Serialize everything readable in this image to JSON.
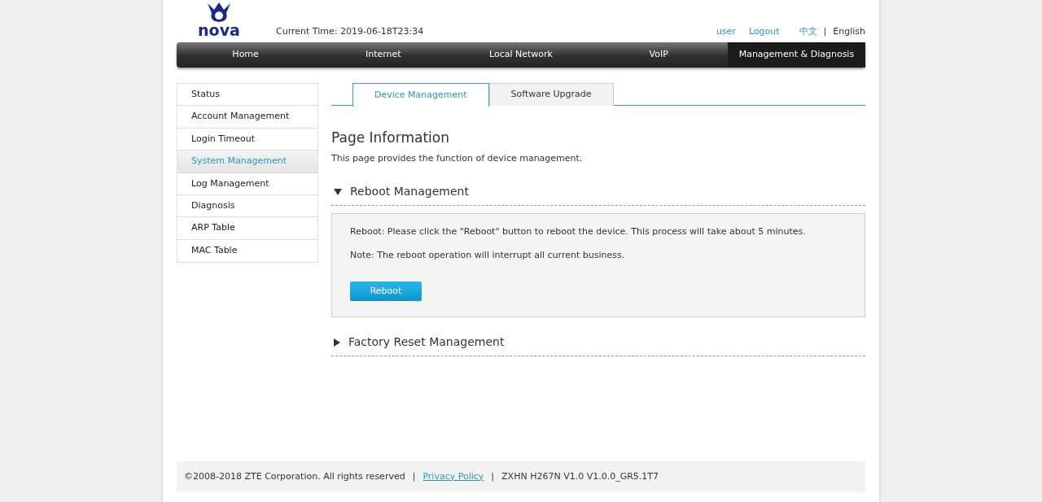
{
  "header": {
    "logo_text": "nova",
    "current_time": "Current Time: 2019-06-18T23:34",
    "user": "user",
    "logout": "Logout",
    "languages": [
      {
        "label": "中文",
        "selected": false
      },
      {
        "label": "English",
        "selected": true
      }
    ],
    "language_separator": "|"
  },
  "nav": [
    {
      "label": "Home",
      "selected": false
    },
    {
      "label": "Internet",
      "selected": false
    },
    {
      "label": "Local Network",
      "selected": false
    },
    {
      "label": "VoIP",
      "selected": false
    },
    {
      "label": "Management & Diagnosis",
      "selected": true
    }
  ],
  "sidebar": {
    "items": [
      {
        "label": "Status",
        "selected": false
      },
      {
        "label": "Account Management",
        "selected": false
      },
      {
        "label": "Login Timeout",
        "selected": false
      },
      {
        "label": "System Management",
        "selected": true
      },
      {
        "label": "Log Management",
        "selected": false
      },
      {
        "label": "Diagnosis",
        "selected": false
      },
      {
        "label": "ARP Table",
        "selected": false
      },
      {
        "label": "MAC Table",
        "selected": false
      }
    ]
  },
  "tabs": [
    {
      "label": "Device Management",
      "selected": true
    },
    {
      "label": "Software Upgrade",
      "selected": false
    }
  ],
  "page_info": {
    "title": "Page Information",
    "description": "This page provides the function of device management."
  },
  "sections": [
    {
      "title": "Reboot Management",
      "expanded": true,
      "lines": [
        "Reboot: Please click the \"Reboot\" button to reboot the device. This process will take about 5 minutes.",
        "Note: The reboot operation will interrupt all current business."
      ],
      "button": "Reboot"
    },
    {
      "title": "Factory Reset Management",
      "expanded": false
    }
  ],
  "footer": {
    "copyright": "©2008-2018 ZTE Corporation. All rights reserved",
    "separator_1": "|",
    "privacy_link": "Privacy Policy",
    "separator_2": "|",
    "version": "ZXHN H267N V1.0 V1.0.0_GR5.1T7"
  }
}
